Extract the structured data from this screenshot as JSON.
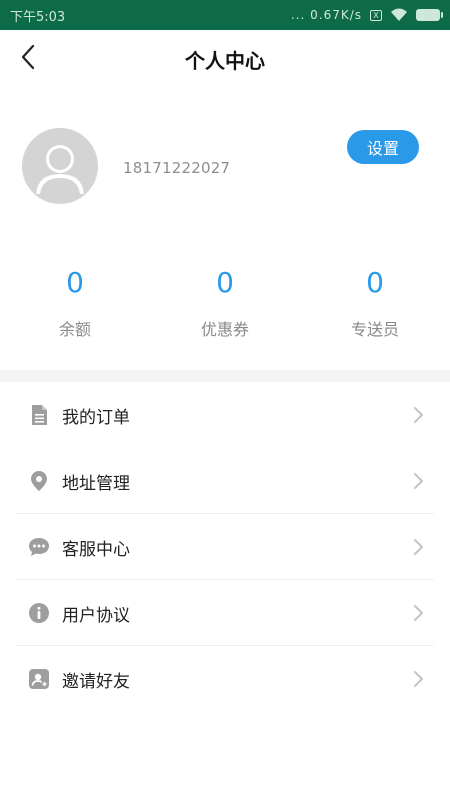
{
  "status_bar": {
    "time": "下午5:03",
    "network_speed": "... 0.67K/s",
    "sim_badge": "X"
  },
  "header": {
    "title": "个人中心"
  },
  "profile": {
    "phone": "18171222027",
    "settings_label": "设置"
  },
  "stats": [
    {
      "value": "0",
      "label": "余额"
    },
    {
      "value": "0",
      "label": "优惠券"
    },
    {
      "value": "0",
      "label": "专送员"
    }
  ],
  "menu": [
    {
      "label": "我的订单",
      "icon": "document-icon"
    },
    {
      "label": "地址管理",
      "icon": "location-pin-icon"
    },
    {
      "label": "客服中心",
      "icon": "chat-bubble-icon"
    },
    {
      "label": "用户协议",
      "icon": "info-icon"
    },
    {
      "label": "邀请好友",
      "icon": "invite-user-icon"
    }
  ],
  "colors": {
    "accent": "#2a9ae8",
    "status_bar": "#0e6b4a",
    "icon_gray": "#9e9e9e"
  }
}
